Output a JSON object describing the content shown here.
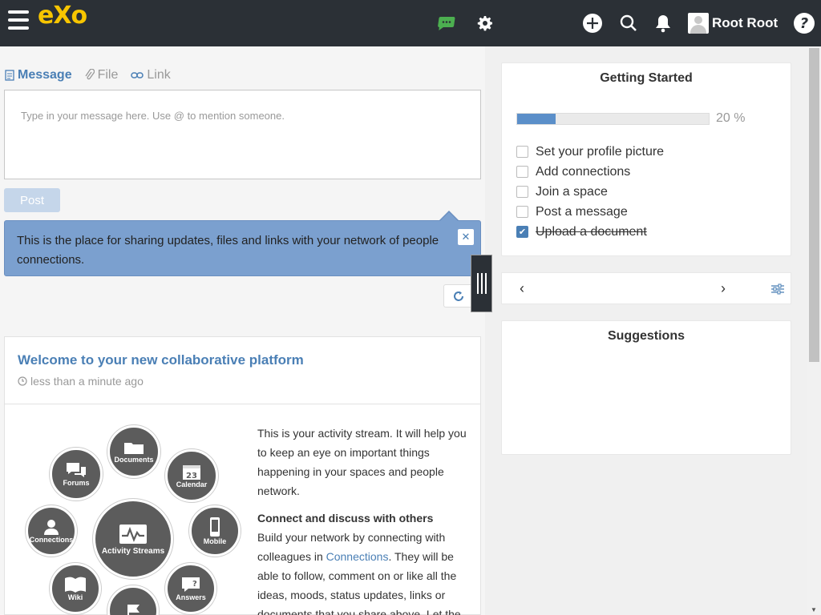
{
  "app": {
    "logo": "eXo"
  },
  "user": {
    "name": "Root Root"
  },
  "composer": {
    "tabs": [
      {
        "label": "Message",
        "icon": "document-icon",
        "active": true
      },
      {
        "label": "File",
        "icon": "paperclip-icon",
        "active": false
      },
      {
        "label": "Link",
        "icon": "link-icon",
        "active": false
      }
    ],
    "placeholder": "Type in your message here. Use @ to mention someone.",
    "post_label": "Post"
  },
  "tip": {
    "text": "This is the place for sharing updates, files and links with your network of people connections.",
    "close": "✕"
  },
  "activity": {
    "title": "Welcome to your new collaborative platform",
    "time": "less than a minute ago",
    "diagram": {
      "center": "Activity Streams",
      "items": [
        "Documents",
        "Calendar",
        "Mobile",
        "Answers",
        "Wiki",
        "Connections",
        "Forums",
        "23"
      ]
    },
    "intro": "This is your activity stream. It will help you to keep an eye on important things happening in your spaces and people network.",
    "section_title": "Connect and discuss with others",
    "section_text_1": "Build your network by connecting with colleagues in ",
    "section_link": "Connections",
    "section_text_2": ". They will be able to follow, comment on or like all the ideas, moods, status updates, links or documents that you share above. Let the"
  },
  "getting_started": {
    "title": "Getting Started",
    "progress": 20,
    "progress_label": "20 %",
    "tasks": [
      {
        "label": "Set your profile picture",
        "done": false
      },
      {
        "label": "Add connections",
        "done": false
      },
      {
        "label": "Join a space",
        "done": false
      },
      {
        "label": "Post a message",
        "done": false
      },
      {
        "label": "Upload a document",
        "done": true
      }
    ]
  },
  "navigator": {
    "prev": "‹",
    "next": "›"
  },
  "suggestions": {
    "title": "Suggestions"
  },
  "colors": {
    "topbar": "#2b3036",
    "accent": "#4a7fb5",
    "logo": "#f7c500",
    "tip_bg": "#7ba0cf",
    "chat_icon": "#4caf50"
  }
}
